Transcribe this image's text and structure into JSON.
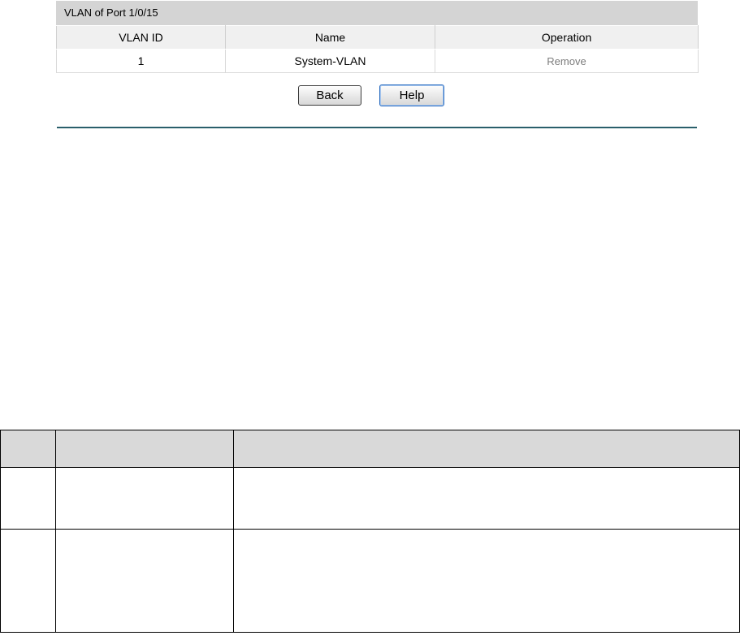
{
  "panel": {
    "title": "VLAN of Port 1/0/15",
    "columns": [
      "VLAN ID",
      "Name",
      "Operation"
    ],
    "rows": [
      {
        "vlan_id": "1",
        "name": "System-VLAN",
        "operation": "Remove"
      }
    ]
  },
  "buttons": {
    "back": "Back",
    "help": "Help"
  },
  "colors": {
    "panel_header_bg": "#d4d4d4",
    "column_header_bg": "#f0f0f0",
    "divider": "#2a5f6b",
    "remove_link": "#7c7c7c",
    "grid_header_bg": "#d9d9d9"
  }
}
